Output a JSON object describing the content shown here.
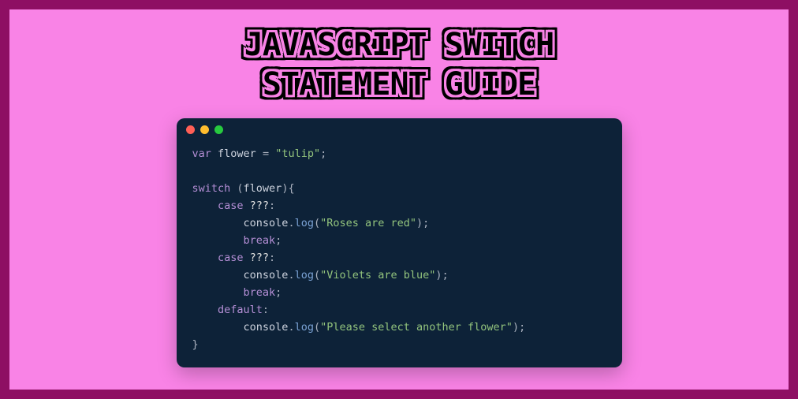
{
  "title_line1": "JavaScript Switch",
  "title_line2": "Statement Guide",
  "dots": {
    "red": "#ff5f56",
    "yellow": "#ffbd2e",
    "green": "#27c93f"
  },
  "code": {
    "var_kw": "var",
    "var_name": "flower",
    "assign": " = ",
    "var_value": "\"tulip\"",
    "semi": ";",
    "blank": "",
    "switch_kw": "switch",
    "switch_open": " (",
    "switch_var": "flower",
    "switch_close": "){",
    "case_kw": "case",
    "case1_val": " ???",
    "colon": ":",
    "console": "console",
    "dot": ".",
    "log": "log",
    "open_paren": "(",
    "close_paren": ")",
    "log1_str": "\"Roses are red\"",
    "break_kw": "break",
    "case2_val": " ???",
    "log2_str": "\"Violets are blue\"",
    "default_kw": "default",
    "log3_str": "\"Please select another flower\"",
    "close_brace": "}",
    "indent1": "    ",
    "indent2": "        "
  }
}
